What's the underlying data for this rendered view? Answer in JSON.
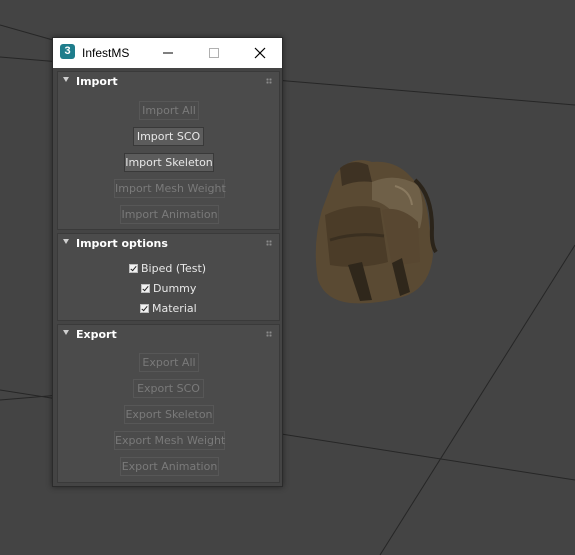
{
  "window": {
    "title": "InfestMS",
    "icon_text": "3",
    "icon_color": "#1e7d8c",
    "controls": {
      "minimize": "minimize-icon",
      "maximize": "maximize-icon",
      "close": "close-icon"
    }
  },
  "rollouts": {
    "import": {
      "title": "Import",
      "buttons": [
        {
          "label": "Import All",
          "enabled": false
        },
        {
          "label": "Import SCO",
          "enabled": true
        },
        {
          "label": "Import Skeleton",
          "enabled": true
        },
        {
          "label": "Import Mesh Weight",
          "enabled": false
        },
        {
          "label": "Import Animation",
          "enabled": false
        }
      ]
    },
    "import_options": {
      "title": "Import options",
      "checkboxes": [
        {
          "label": "Biped (Test)",
          "checked": true
        },
        {
          "label": "Dummy",
          "checked": true
        },
        {
          "label": "Material",
          "checked": true
        }
      ]
    },
    "export": {
      "title": "Export",
      "buttons": [
        {
          "label": "Export All",
          "enabled": false
        },
        {
          "label": "Export SCO",
          "enabled": false
        },
        {
          "label": "Export Skeleton",
          "enabled": false
        },
        {
          "label": "Export Mesh Weight",
          "enabled": false
        },
        {
          "label": "Export Animation",
          "enabled": false
        }
      ]
    }
  },
  "viewport": {
    "background": "#444444",
    "model": "backpack"
  }
}
